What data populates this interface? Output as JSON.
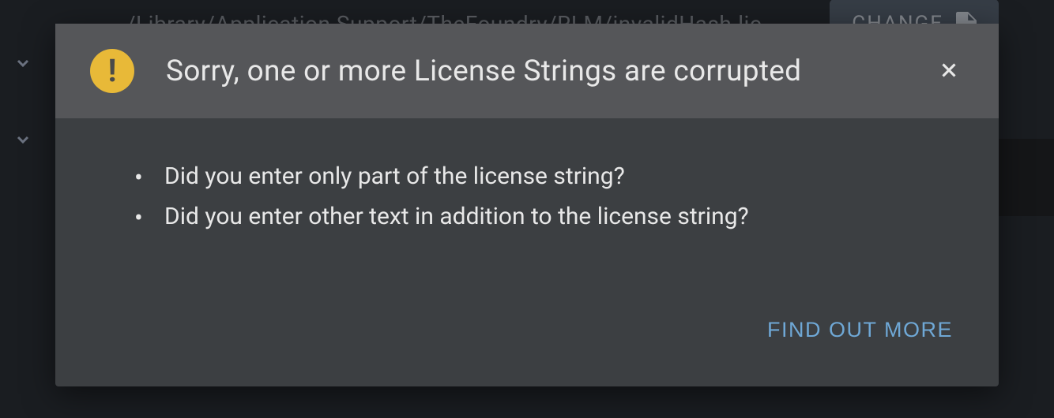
{
  "background": {
    "path_text": "/Library/Application Support/TheFoundry/RLM/invalidHash.lic",
    "change_label": "CHANGE"
  },
  "dialog": {
    "title": "Sorry, one or more License Strings are corrupted",
    "bullets": [
      "Did you enter only part of the license string?",
      "Did you enter other text in addition to the license string?"
    ],
    "find_out_more_label": "FIND OUT MORE"
  }
}
